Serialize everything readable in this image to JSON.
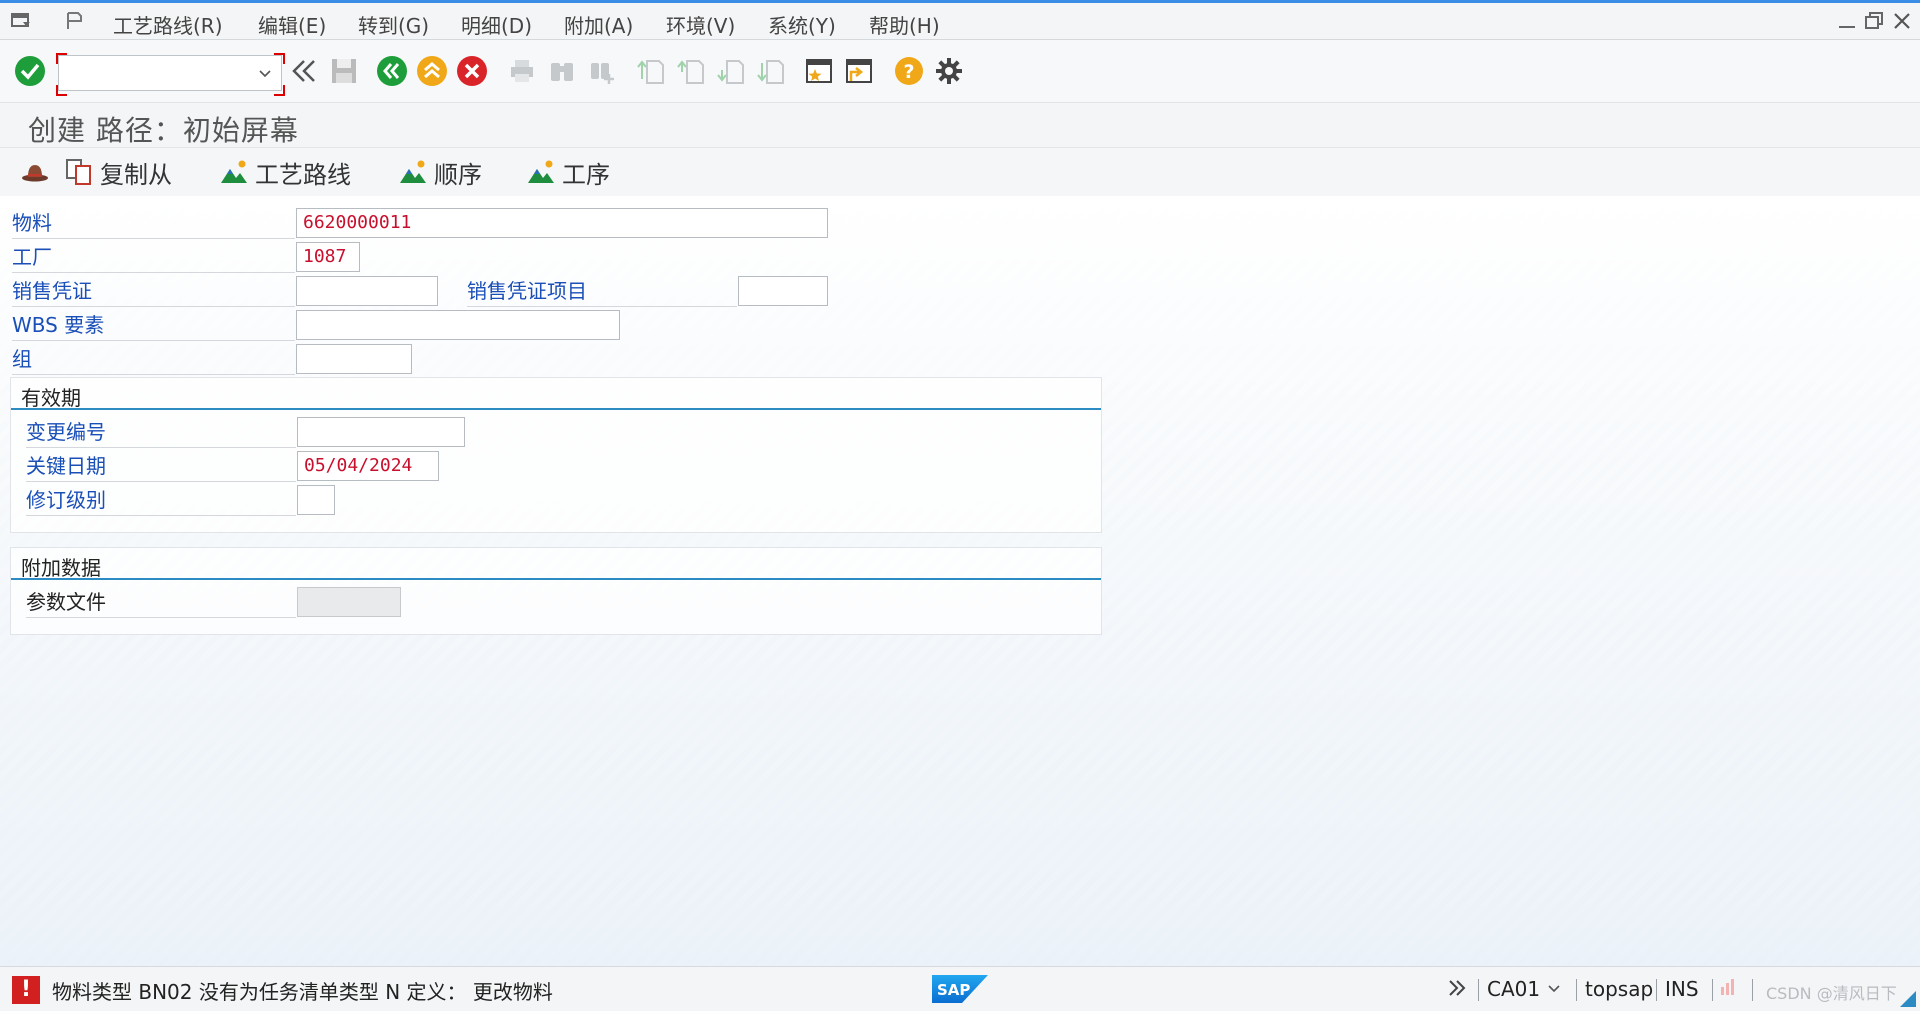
{
  "menu": {
    "items": [
      "工艺路线(R)",
      "编辑(E)",
      "转到(G)",
      "明细(D)",
      "附加(A)",
      "环境(V)",
      "系统(Y)",
      "帮助(H)"
    ]
  },
  "toolbar": {
    "command_field": "",
    "icons": [
      "enter-icon",
      "back-double-icon",
      "save-icon",
      "back-icon",
      "exit-icon",
      "cancel-icon",
      "print-icon",
      "find-icon",
      "find-next-icon",
      "first-page-icon",
      "previous-page-icon",
      "next-page-icon",
      "last-page-icon",
      "create-session-icon",
      "shortcut-icon",
      "help-icon",
      "settings-icon"
    ]
  },
  "title": "创建 路径：初始屏幕",
  "app_toolbar": {
    "copy_from": "复制从",
    "routing": "工艺路线",
    "sequence": "顺序",
    "operation": "工序"
  },
  "fields": {
    "material_label": "物料",
    "material_value": "6620000011",
    "plant_label": "工厂",
    "plant_value": "1087",
    "sales_doc_label": "销售凭证",
    "sales_doc_value": "",
    "sales_doc_item_label": "销售凭证项目",
    "sales_doc_item_value": "",
    "wbs_label": "WBS 要素",
    "wbs_value": "",
    "group_label": "组",
    "group_value": ""
  },
  "validity": {
    "title": "有效期",
    "change_no_label": "变更编号",
    "change_no_value": "",
    "key_date_label": "关键日期",
    "key_date_value": "05/04/2024",
    "revision_label": "修订级别",
    "revision_value": ""
  },
  "additional": {
    "title": "附加数据",
    "profile_label": "参数文件",
    "profile_value": ""
  },
  "status": {
    "type": "error",
    "message": "物料类型 BN02 没有为任务清单类型 N 定义： 更改物料",
    "system": "CA01",
    "server": "topsap",
    "mode": "INS",
    "watermark": "CSDN @清风日下"
  },
  "colors": {
    "accent": "#2d8bc4",
    "label_blue": "#1a4fb8",
    "value_red": "#c8102e",
    "error_red": "#d21f1f"
  }
}
